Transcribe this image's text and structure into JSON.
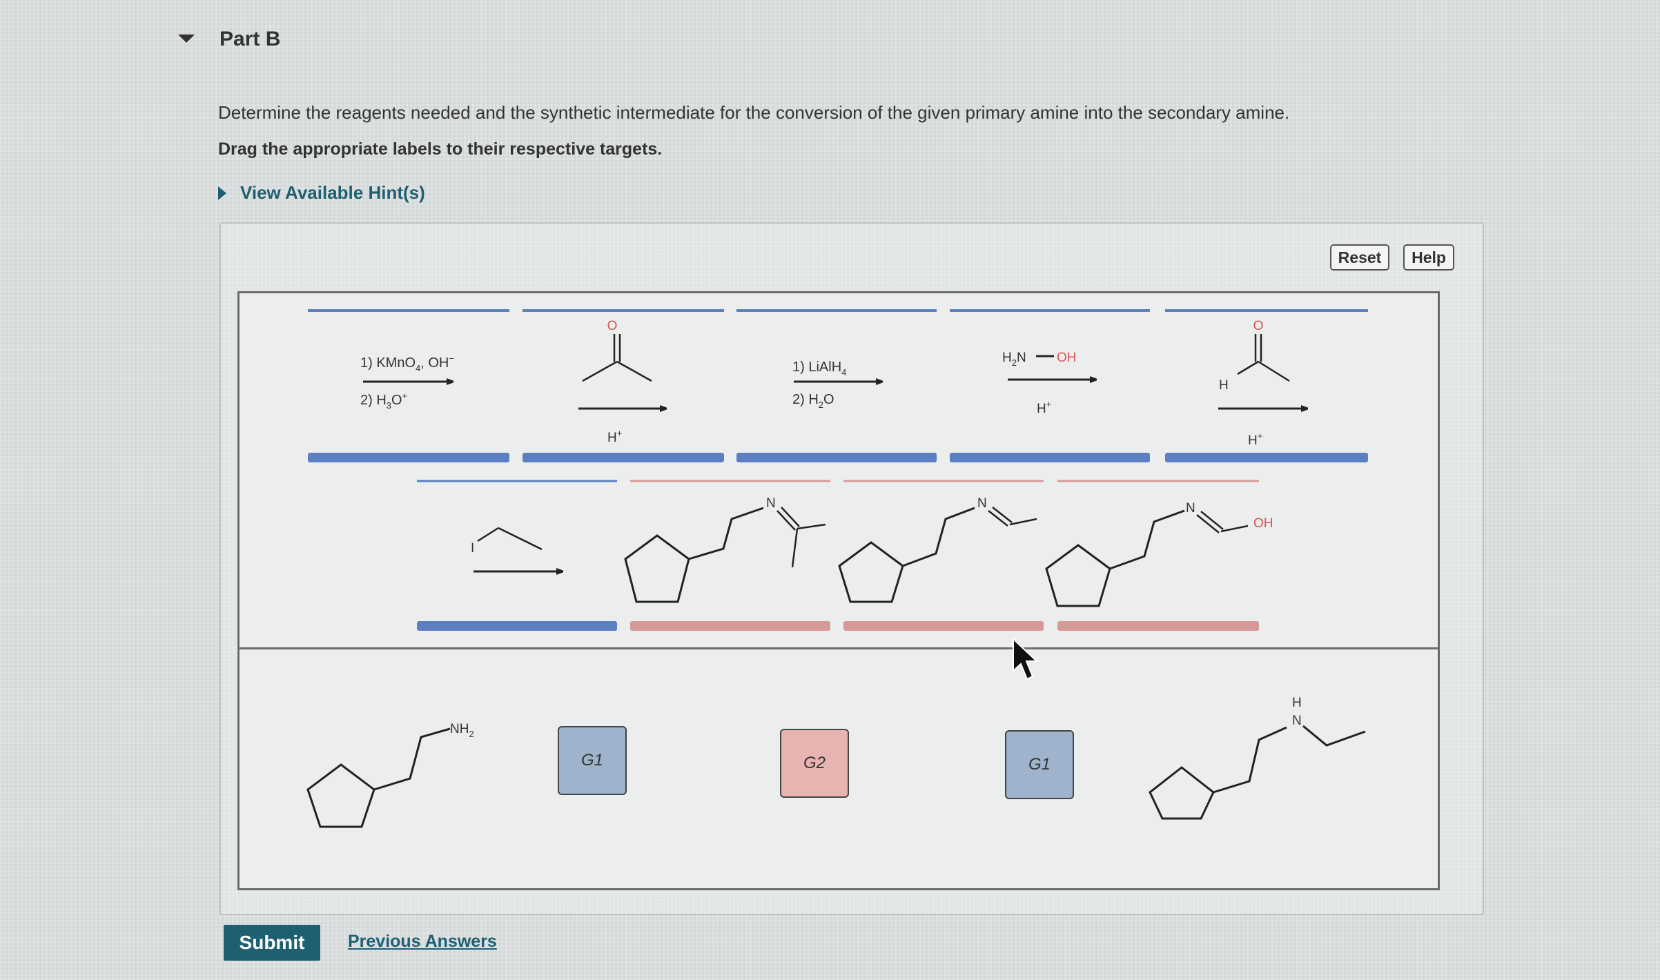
{
  "part": {
    "title": "Part B"
  },
  "instructions": {
    "main": "Determine the reagents needed and the synthetic intermediate for the conversion of the given primary amine into the secondary amine.",
    "drag": "Drag the appropriate labels to their respective targets."
  },
  "hint": {
    "label": "View Available Hint(s)"
  },
  "toolbar": {
    "reset_label": "Reset",
    "help_label": "Help"
  },
  "reagents": {
    "kmno4": {
      "line1": "1) KMnO",
      "sub1": "4",
      "line1_tail": ", OH",
      "sup1": "−",
      "line2": "2) H",
      "sub2": "3",
      "line2_tail": "O",
      "sup2": "+"
    },
    "acetone": {
      "o": "O",
      "h": "H",
      "sup": "+"
    },
    "lialh4": {
      "line1": "1) LiAlH",
      "sub1": "4",
      "line2": "2) H",
      "sub2": "2",
      "line2_tail": "O"
    },
    "hydroxylamine": {
      "h": "H",
      "sub": "2",
      "n": "N",
      "oh": "OH",
      "hplus": "H",
      "sup": "+"
    },
    "acetaldehyde": {
      "o": "O",
      "h": "H",
      "hplus": "H",
      "sup": "+"
    },
    "ethyl_iodide": {
      "i": "I"
    }
  },
  "structures": {
    "imine_isopropylidene": {
      "n": "N"
    },
    "imine_ethylidene": {
      "n": "N"
    },
    "oxime_like": {
      "n": "N",
      "oh": "OH"
    },
    "start_amine": {
      "nh": "NH",
      "sub": "2"
    },
    "product_amine": {
      "h": "H",
      "n": "N"
    }
  },
  "labels": {
    "g1_a": "G1",
    "g2": "G2",
    "g1_b": "G1"
  },
  "footer": {
    "submit_label": "Submit",
    "previous_answers_label": "Previous Answers"
  },
  "colors": {
    "blue_target": "#5b7fc1",
    "red_target": "#d59a97",
    "teal": "#1f5f72",
    "oxygen_red": "#d9534f"
  }
}
